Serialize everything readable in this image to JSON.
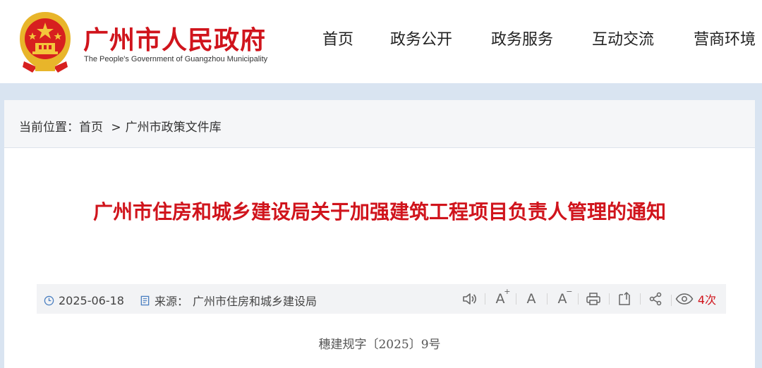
{
  "site": {
    "title": "广州市人民政府",
    "subtitle": "The People's Government of Guangzhou Municipality"
  },
  "nav": {
    "items": [
      {
        "label": "首页"
      },
      {
        "label": "政务公开"
      },
      {
        "label": "政务服务"
      },
      {
        "label": "互动交流"
      },
      {
        "label": "营商环境"
      }
    ]
  },
  "breadcrumb": {
    "prefix": "当前位置：",
    "home": "首页",
    "separator": ">",
    "current": "广州市政策文件库"
  },
  "article": {
    "title": "广州市住房和城乡建设局关于加强建筑工程项目负责人管理的通知",
    "date": "2025-06-18",
    "source_label": "来源：",
    "source": "广州市住房和城乡建设局",
    "view_count": "4次",
    "doc_number": "穗建规字〔2025〕9号"
  },
  "colors": {
    "brand_red": "#d0141c",
    "page_bg": "#d9e4f1",
    "meta_bg": "#f2f3f5"
  },
  "icons": {
    "date": "clock-icon",
    "source": "document-icon",
    "audio": "speaker-icon",
    "font_larger": "font-increase-icon",
    "font_default": "font-reset-icon",
    "font_smaller": "font-decrease-icon",
    "print": "printer-icon",
    "collect": "bookmark-icon",
    "share": "share-icon",
    "views": "eye-icon"
  }
}
